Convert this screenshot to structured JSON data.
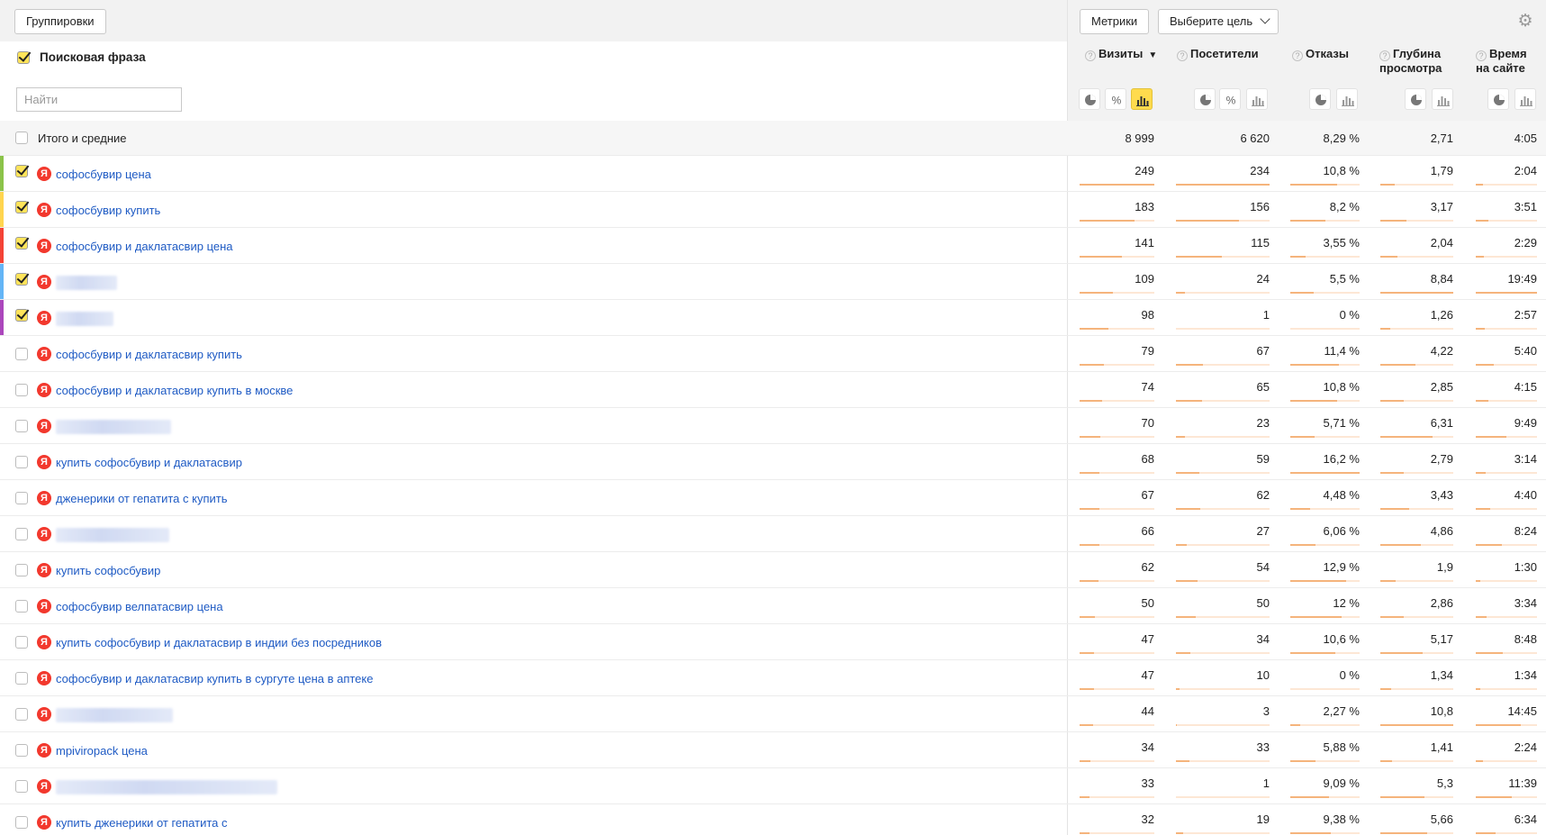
{
  "toolbar": {
    "groupings_label": "Группировки",
    "metrics_label": "Метрики",
    "goal_label": "Выберите цель"
  },
  "header": {
    "phrase_title": "Поисковая фраза",
    "search_placeholder": "Найти",
    "columns": [
      {
        "line1": "Визиты",
        "line2": "",
        "sorted": true
      },
      {
        "line1": "Посетители",
        "line2": ""
      },
      {
        "line1": "Отказы",
        "line2": ""
      },
      {
        "line1": "Глубина",
        "line2": "просмотра"
      },
      {
        "line1": "Время",
        "line2": "на сайте"
      }
    ],
    "sort_indicator": "▼"
  },
  "totals": {
    "label": "Итого и средние",
    "visits": "8 999",
    "visitors": "6 620",
    "bounce": "8,29 %",
    "depth": "2,71",
    "time": "4:05"
  },
  "rows": [
    {
      "phrase": "софосбувир цена",
      "checked": true,
      "color": "#8bc34a",
      "visits": "249",
      "visitors": "234",
      "bounce": "10,8 %",
      "depth": "1,79",
      "time": "2:04",
      "bars": [
        1.0,
        1.0,
        0.67,
        0.2,
        0.12
      ]
    },
    {
      "phrase": "софосбувир купить",
      "checked": true,
      "color": "#ffd54f",
      "visits": "183",
      "visitors": "156",
      "bounce": "8,2 %",
      "depth": "3,17",
      "time": "3:51",
      "bars": [
        0.73,
        0.67,
        0.51,
        0.36,
        0.2
      ]
    },
    {
      "phrase": "софосбувир и даклатасвир цена",
      "checked": true,
      "color": "#f44336",
      "visits": "141",
      "visitors": "115",
      "bounce": "3,55 %",
      "depth": "2,04",
      "time": "2:29",
      "bars": [
        0.57,
        0.49,
        0.22,
        0.23,
        0.13
      ]
    },
    {
      "phrase": "",
      "blur_width": 68,
      "checked": true,
      "color": "#64b5f6",
      "visits": "109",
      "visitors": "24",
      "bounce": "5,5 %",
      "depth": "8,84",
      "time": "19:49",
      "bars": [
        0.44,
        0.1,
        0.34,
        1.0,
        1.0
      ]
    },
    {
      "phrase": "",
      "blur_width": 64,
      "checked": true,
      "color": "#ab47bc",
      "visits": "98",
      "visitors": "1",
      "bounce": "0 %",
      "depth": "1,26",
      "time": "2:57",
      "bars": [
        0.39,
        0.0,
        0.0,
        0.14,
        0.15
      ]
    },
    {
      "phrase": "софосбувир и даклатасвир купить",
      "checked": false,
      "visits": "79",
      "visitors": "67",
      "bounce": "11,4 %",
      "depth": "4,22",
      "time": "5:40",
      "bars": [
        0.32,
        0.29,
        0.7,
        0.48,
        0.29
      ]
    },
    {
      "phrase": "софосбувир и даклатасвир купить в москве",
      "checked": false,
      "visits": "74",
      "visitors": "65",
      "bounce": "10,8 %",
      "depth": "2,85",
      "time": "4:15",
      "bars": [
        0.3,
        0.28,
        0.67,
        0.32,
        0.21
      ]
    },
    {
      "phrase": "",
      "blur_width": 128,
      "checked": false,
      "visits": "70",
      "visitors": "23",
      "bounce": "5,71 %",
      "depth": "6,31",
      "time": "9:49",
      "bars": [
        0.28,
        0.1,
        0.35,
        0.71,
        0.5
      ]
    },
    {
      "phrase": "купить софосбувир и даклатасвир",
      "checked": false,
      "visits": "68",
      "visitors": "59",
      "bounce": "16,2 %",
      "depth": "2,79",
      "time": "3:14",
      "bars": [
        0.27,
        0.25,
        1.0,
        0.32,
        0.16
      ]
    },
    {
      "phrase": "дженерики от гепатита с купить",
      "checked": false,
      "visits": "67",
      "visitors": "62",
      "bounce": "4,48 %",
      "depth": "3,43",
      "time": "4:40",
      "bars": [
        0.27,
        0.26,
        0.28,
        0.39,
        0.24
      ]
    },
    {
      "phrase": "",
      "blur_width": 126,
      "checked": false,
      "visits": "66",
      "visitors": "27",
      "bounce": "6,06 %",
      "depth": "4,86",
      "time": "8:24",
      "bars": [
        0.27,
        0.12,
        0.37,
        0.55,
        0.42
      ]
    },
    {
      "phrase": "купить софосбувир",
      "checked": false,
      "visits": "62",
      "visitors": "54",
      "bounce": "12,9 %",
      "depth": "1,9",
      "time": "1:30",
      "bars": [
        0.25,
        0.23,
        0.8,
        0.21,
        0.08
      ]
    },
    {
      "phrase": "софосбувир велпатасвир цена",
      "checked": false,
      "visits": "50",
      "visitors": "50",
      "bounce": "12 %",
      "depth": "2,86",
      "time": "3:34",
      "bars": [
        0.2,
        0.21,
        0.74,
        0.32,
        0.18
      ]
    },
    {
      "phrase": "купить софосбувир и даклатасвир в индии без посредников",
      "checked": false,
      "visits": "47",
      "visitors": "34",
      "bounce": "10,6 %",
      "depth": "5,17",
      "time": "8:48",
      "bars": [
        0.19,
        0.15,
        0.65,
        0.58,
        0.44
      ]
    },
    {
      "phrase": "софосбувир и даклатасвир купить в сургуте цена в аптеке",
      "checked": false,
      "visits": "47",
      "visitors": "10",
      "bounce": "0 %",
      "depth": "1,34",
      "time": "1:34",
      "bars": [
        0.19,
        0.04,
        0.0,
        0.15,
        0.08
      ]
    },
    {
      "phrase": "",
      "blur_width": 130,
      "checked": false,
      "visits": "44",
      "visitors": "3",
      "bounce": "2,27 %",
      "depth": "10,8",
      "time": "14:45",
      "bars": [
        0.18,
        0.01,
        0.14,
        1.0,
        0.74
      ]
    },
    {
      "phrase": "mpiviropack цена",
      "checked": false,
      "visits": "34",
      "visitors": "33",
      "bounce": "5,88 %",
      "depth": "1,41",
      "time": "2:24",
      "bars": [
        0.14,
        0.14,
        0.36,
        0.16,
        0.12
      ]
    },
    {
      "phrase": "",
      "blur_width": 246,
      "checked": false,
      "visits": "33",
      "visitors": "1",
      "bounce": "9,09 %",
      "depth": "5,3",
      "time": "11:39",
      "bars": [
        0.13,
        0.0,
        0.56,
        0.6,
        0.59
      ]
    },
    {
      "phrase": "купить дженерики от гепатита с",
      "checked": false,
      "visits": "32",
      "visitors": "19",
      "bounce": "9,38 %",
      "depth": "5,66",
      "time": "6:34",
      "bars": [
        0.13,
        0.08,
        0.58,
        0.64,
        0.33
      ]
    }
  ],
  "colors": {
    "accent": "#ffdb4d",
    "link": "#1f5bc4",
    "yandex": "#f2382d",
    "bar": "#f5b47c"
  }
}
